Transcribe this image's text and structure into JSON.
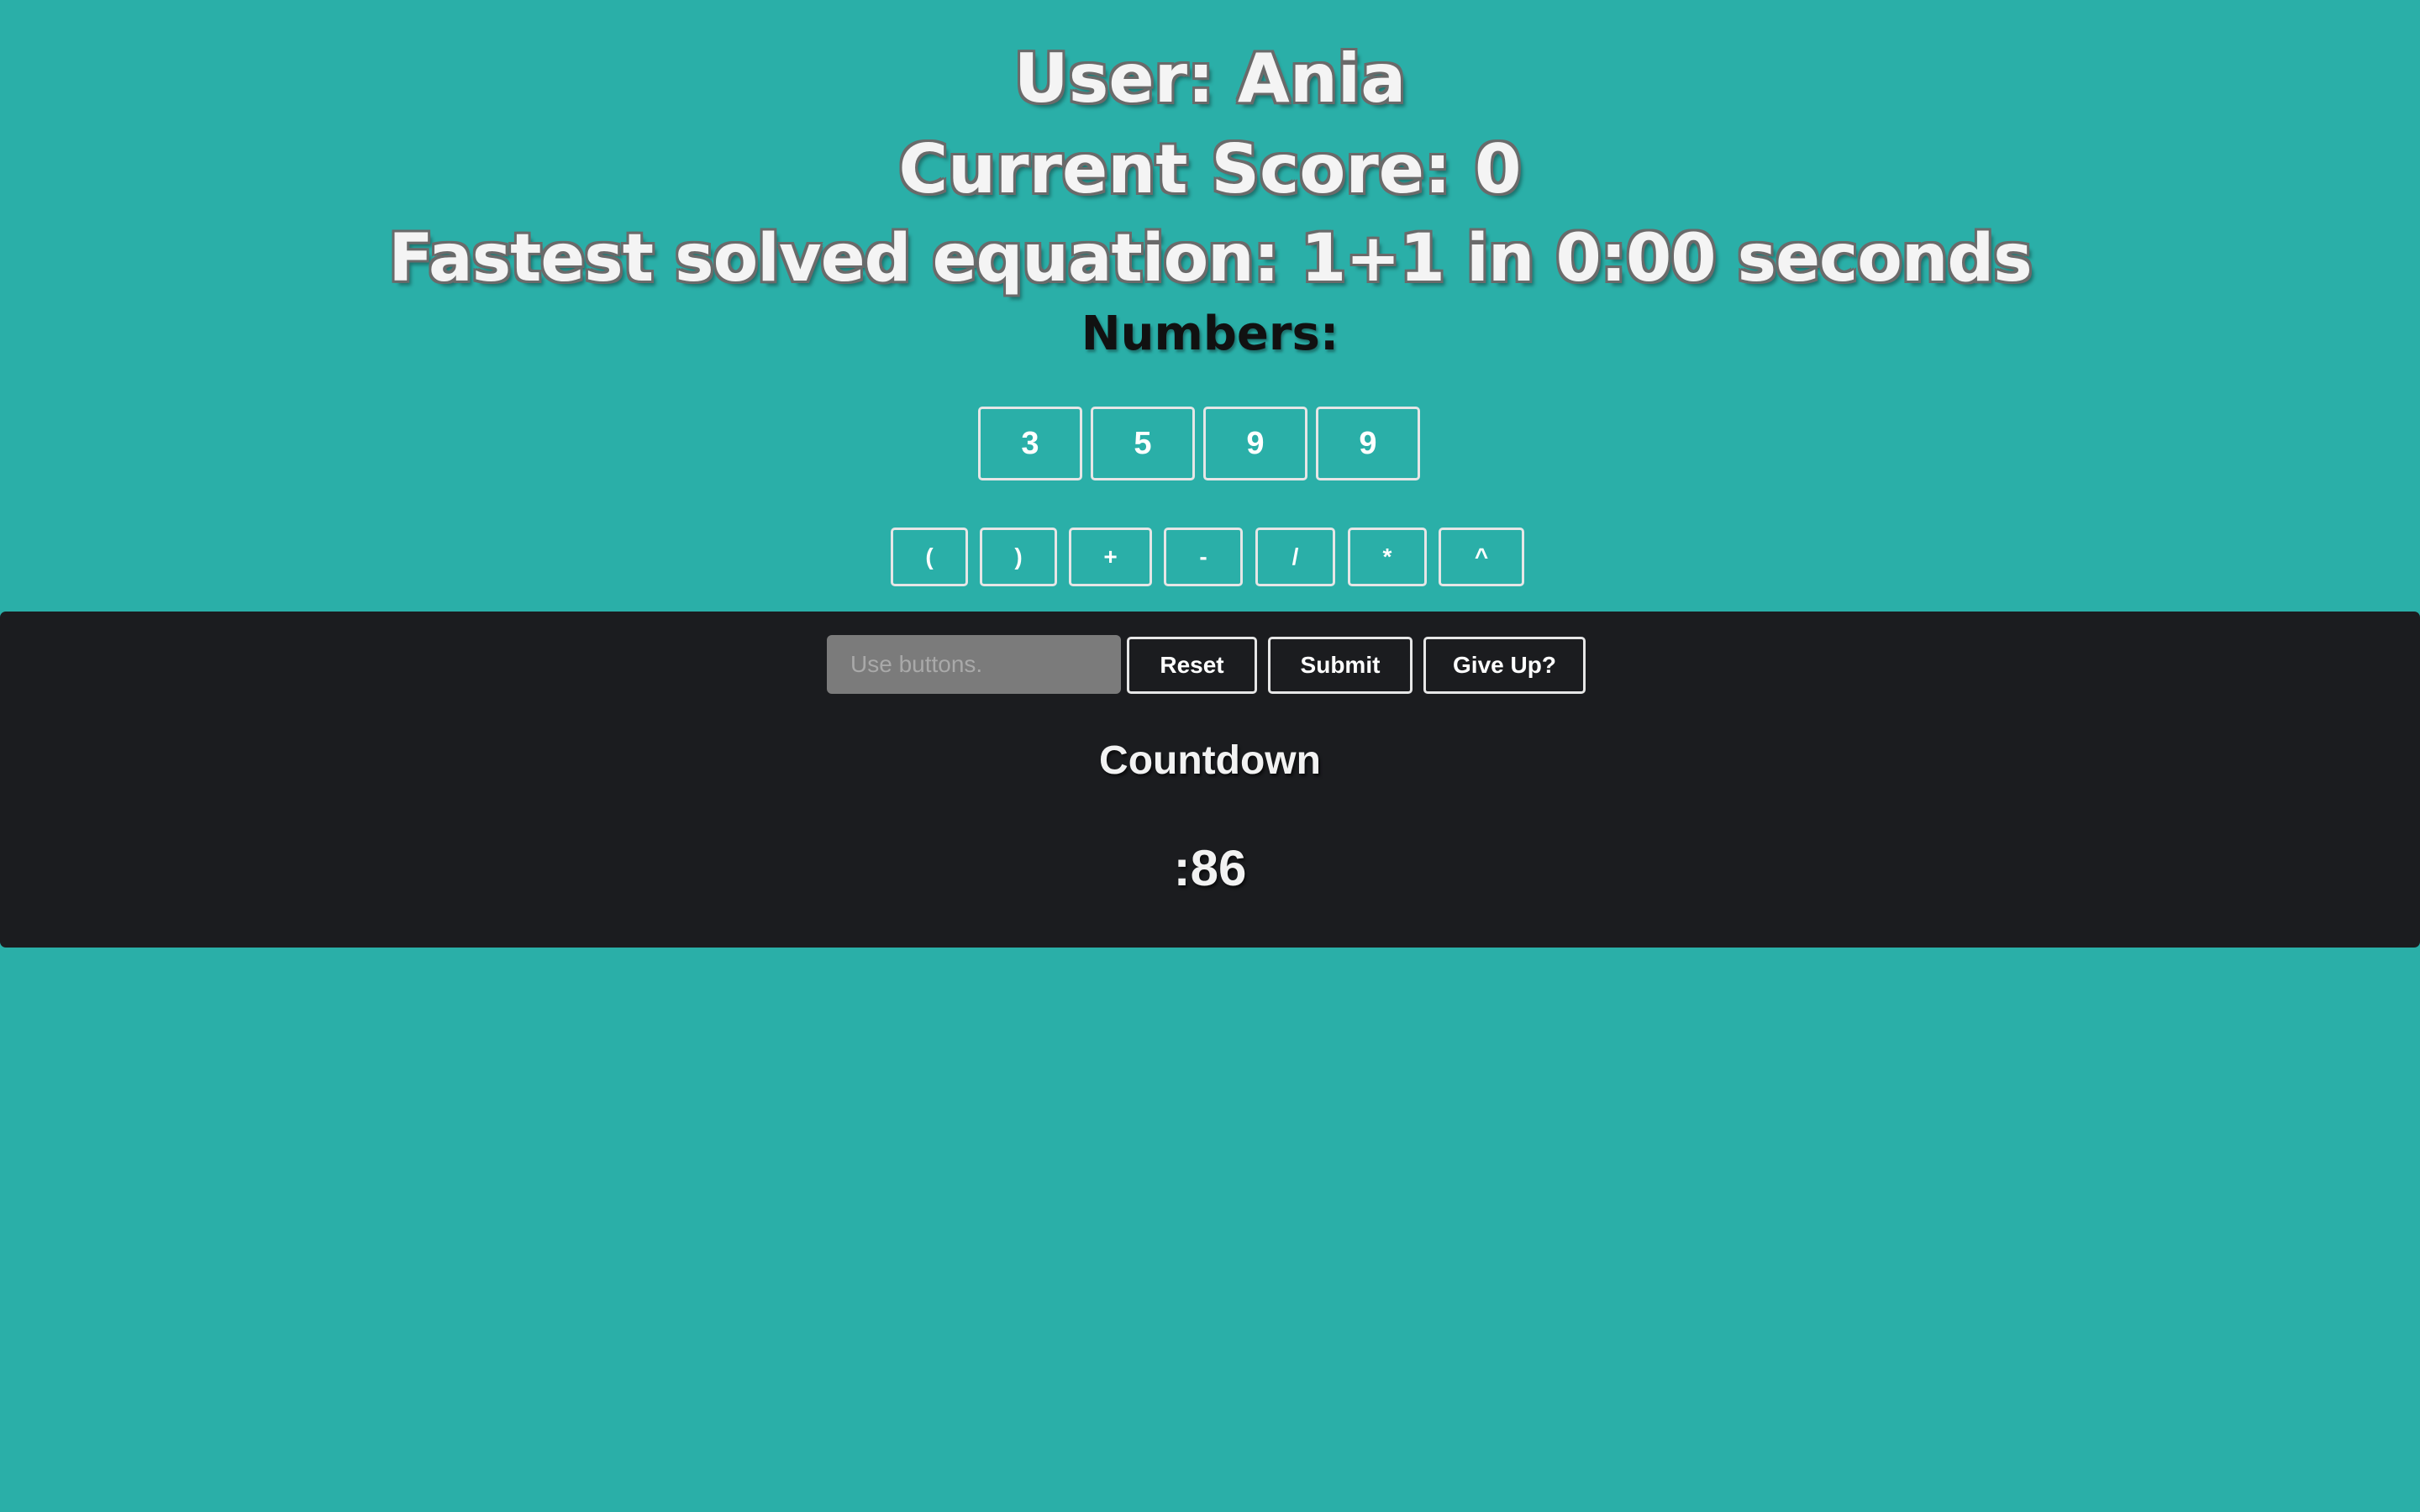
{
  "header": {
    "user_line": "User: Ania",
    "score_line": "Current Score: 0",
    "fastest_line": "Fastest solved equation: 1+1 in 0:00 seconds"
  },
  "numbers": {
    "label": "Numbers:",
    "tiles": [
      "3",
      "5",
      "9",
      "9"
    ]
  },
  "operators": [
    "(",
    ")",
    "+",
    "-",
    "/",
    "*",
    "^"
  ],
  "controls": {
    "input_value": "",
    "input_placeholder": "Use buttons.",
    "reset_label": "Reset",
    "submit_label": "Submit",
    "give_up_label": "Give Up?"
  },
  "countdown": {
    "title": "Countdown",
    "value": ":86"
  },
  "colors": {
    "background": "#2aafa8",
    "panel": "#1b1c1f",
    "button_border": "#e6e6e6",
    "input_bg": "#7b7b7b"
  }
}
